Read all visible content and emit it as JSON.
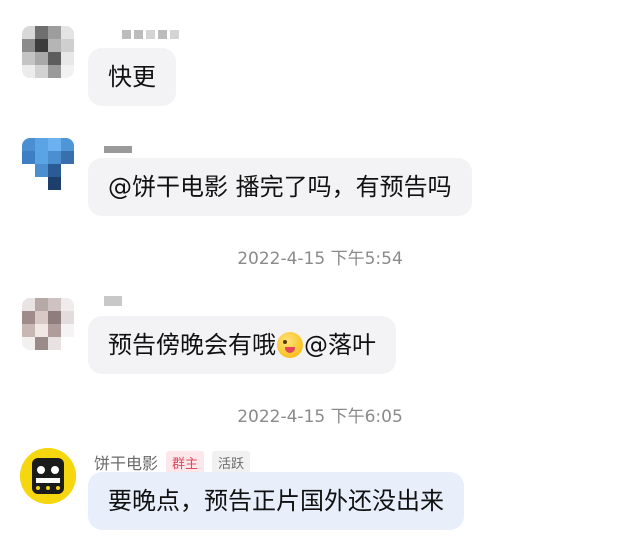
{
  "messages": [
    {
      "text": "快更"
    },
    {
      "text": "@饼干电影 播完了吗，有预告吗"
    },
    {
      "text_before_emoji": "预告傍晚会有哦",
      "emoji": "winking-tongue-emoji",
      "text_after_emoji": "@落叶"
    },
    {
      "sender_name": "饼干电影",
      "badge_owner": "群主",
      "badge_active": "活跃",
      "text": "要晚点，预告正片国外还没出来"
    }
  ],
  "timestamps": [
    "2022-4-15 下午5:54",
    "2022-4-15 下午6:05"
  ],
  "colors": {
    "bubble": "#f3f3f5",
    "bubble_highlight": "#e8effb",
    "owner_badge": "#e0485d"
  }
}
